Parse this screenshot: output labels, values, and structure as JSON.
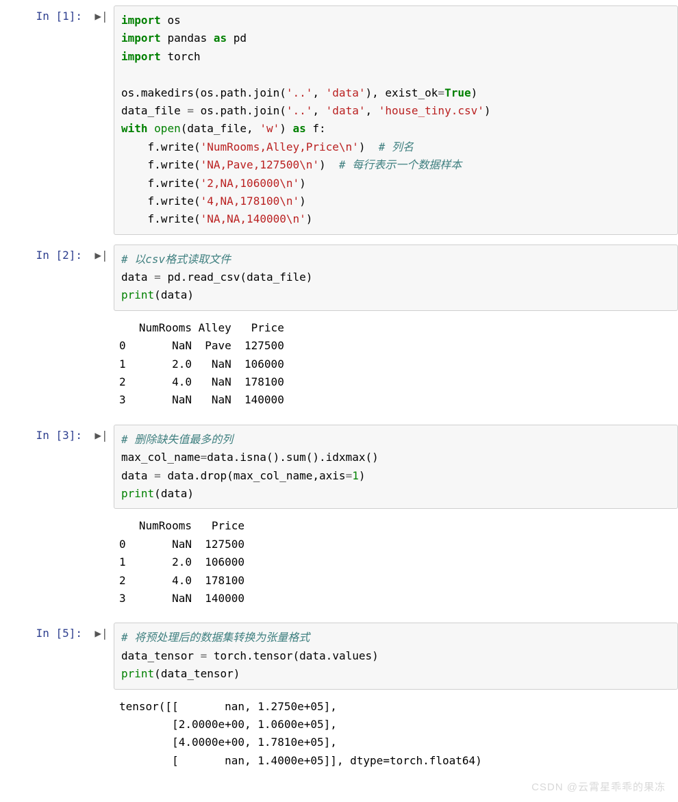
{
  "cells": [
    {
      "prompt": "In  [1]:",
      "code_html": "<span class='kw'>import</span> <span class='nm'>os</span>\n<span class='kw'>import</span> <span class='nm'>pandas</span> <span class='kw'>as</span> <span class='nm'>pd</span>\n<span class='kw'>import</span> <span class='nm'>torch</span>\n\n<span class='nm'>os</span>.<span class='nm'>makedirs</span>(<span class='nm'>os</span>.<span class='nm'>path</span>.<span class='nm'>join</span>(<span class='str'>'..'</span>, <span class='str'>'data'</span>), <span class='nm'>exist_ok</span><span class='op'>=</span><span class='bool'>True</span>)\n<span class='nm'>data_file</span> <span class='op'>=</span> <span class='nm'>os</span>.<span class='nm'>path</span>.<span class='nm'>join</span>(<span class='str'>'..'</span>, <span class='str'>'data'</span>, <span class='str'>'house_tiny.csv'</span>)\n<span class='kw'>with</span> <span class='bi'>open</span>(<span class='nm'>data_file</span>, <span class='str'>'w'</span>) <span class='kw'>as</span> <span class='nm'>f</span>:\n    <span class='nm'>f</span>.<span class='nm'>write</span>(<span class='str'>'NumRooms,Alley,Price\\n'</span>)  <span class='cm'># 列名</span>\n    <span class='nm'>f</span>.<span class='nm'>write</span>(<span class='str'>'NA,Pave,127500\\n'</span>)  <span class='cm'># 每行表示一个数据样本</span>\n    <span class='nm'>f</span>.<span class='nm'>write</span>(<span class='str'>'2,NA,106000\\n'</span>)\n    <span class='nm'>f</span>.<span class='nm'>write</span>(<span class='str'>'4,NA,178100\\n'</span>)\n    <span class='nm'>f</span>.<span class='nm'>write</span>(<span class='str'>'NA,NA,140000\\n'</span>)",
      "output": ""
    },
    {
      "prompt": "In  [2]:",
      "code_html": "<span class='cm'># 以csv格式读取文件</span>\n<span class='nm'>data</span> <span class='op'>=</span> <span class='nm'>pd</span>.<span class='nm'>read_csv</span>(<span class='nm'>data_file</span>)\n<span class='bi'>print</span>(<span class='nm'>data</span>)",
      "output": "   NumRooms Alley   Price\n0       NaN  Pave  127500\n1       2.0   NaN  106000\n2       4.0   NaN  178100\n3       NaN   NaN  140000"
    },
    {
      "prompt": "In  [3]:",
      "code_html": "<span class='cm'># 删除缺失值最多的列</span>\n<span class='nm'>max_col_name</span><span class='op'>=</span><span class='nm'>data</span>.<span class='nm'>isna</span>().<span class='nm'>sum</span>().<span class='nm'>idxmax</span>()\n<span class='nm'>data</span> <span class='op'>=</span> <span class='nm'>data</span>.<span class='nm'>drop</span>(<span class='nm'>max_col_name</span>,<span class='nm'>axis</span><span class='op'>=</span><span class='num'>1</span>)\n<span class='bi'>print</span>(<span class='nm'>data</span>)",
      "output": "   NumRooms   Price\n0       NaN  127500\n1       2.0  106000\n2       4.0  178100\n3       NaN  140000"
    },
    {
      "prompt": "In  [5]:",
      "code_html": "<span class='cm'># 将预处理后的数据集转换为张量格式</span>\n<span class='nm'>data_tensor</span> <span class='op'>=</span> <span class='nm'>torch</span>.<span class='nm'>tensor</span>(<span class='nm'>data</span>.<span class='nm'>values</span>)\n<span class='bi'>print</span>(<span class='nm'>data_tensor</span>)",
      "output": "tensor([[       nan, 1.2750e+05],\n        [2.0000e+00, 1.0600e+05],\n        [4.0000e+00, 1.7810e+05],\n        [       nan, 1.4000e+05]], dtype=torch.float64)"
    }
  ],
  "run_icon": "▶|",
  "watermark": "CSDN @云霄星乖乖的果冻"
}
